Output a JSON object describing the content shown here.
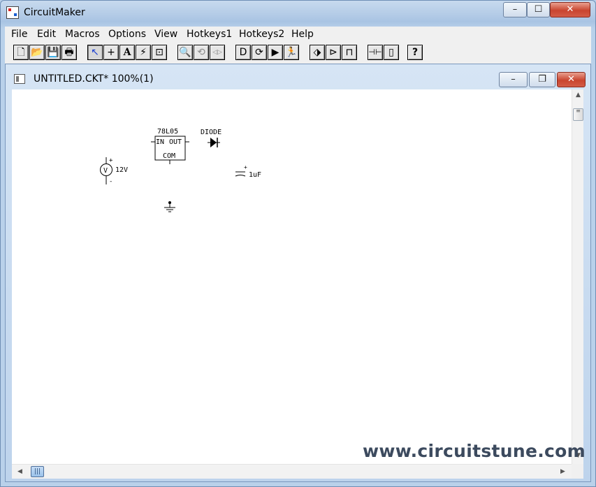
{
  "window": {
    "title": "CircuitMaker",
    "controls": {
      "minimize": "–",
      "maximize": "☐",
      "close": "✕"
    }
  },
  "menu": [
    "File",
    "Edit",
    "Macros",
    "Options",
    "View",
    "Hotkeys1",
    "Hotkeys2",
    "Help"
  ],
  "toolbar": {
    "new": "🗋",
    "open": "📂",
    "save": "💾",
    "print": "🖶",
    "arrow": "↖",
    "wire": "+",
    "text": "A",
    "probe": "⚡",
    "zoom_area": "⊡",
    "zoom": "🔍",
    "rotate": "⟲",
    "mirror": "◁▷",
    "device_gate": "D",
    "device_rotate": "⟳",
    "step": "▶",
    "run": "🏃",
    "probe2": "⬗",
    "digital": "⊳",
    "waveform": "⊓",
    "analog": "⊣⊢",
    "chip": "▯",
    "help": "?"
  },
  "document": {
    "title": "UNTITLED.CKT* 100%(1)",
    "controls": {
      "minimize": "–",
      "restore": "❐",
      "close": "✕"
    }
  },
  "schematic": {
    "regulator_part": "78L05",
    "regulator_in": "IN",
    "regulator_out": "OUT",
    "regulator_com": "COM",
    "diode_label": "DIODE",
    "source_symbol": "V",
    "source_value": "12V",
    "source_plus": "+",
    "source_minus": "-",
    "cap_value": "1uF",
    "cap_plus": "+"
  },
  "scrollbar": {
    "up": "▲",
    "down": "▼",
    "left": "◀",
    "right": "▶",
    "grip": "|||"
  },
  "watermark": "www.circuitstune.com",
  "colors": {
    "title_bar": "#b9d1ea",
    "close_red": "#c9452f",
    "canvas": "#ffffff"
  }
}
